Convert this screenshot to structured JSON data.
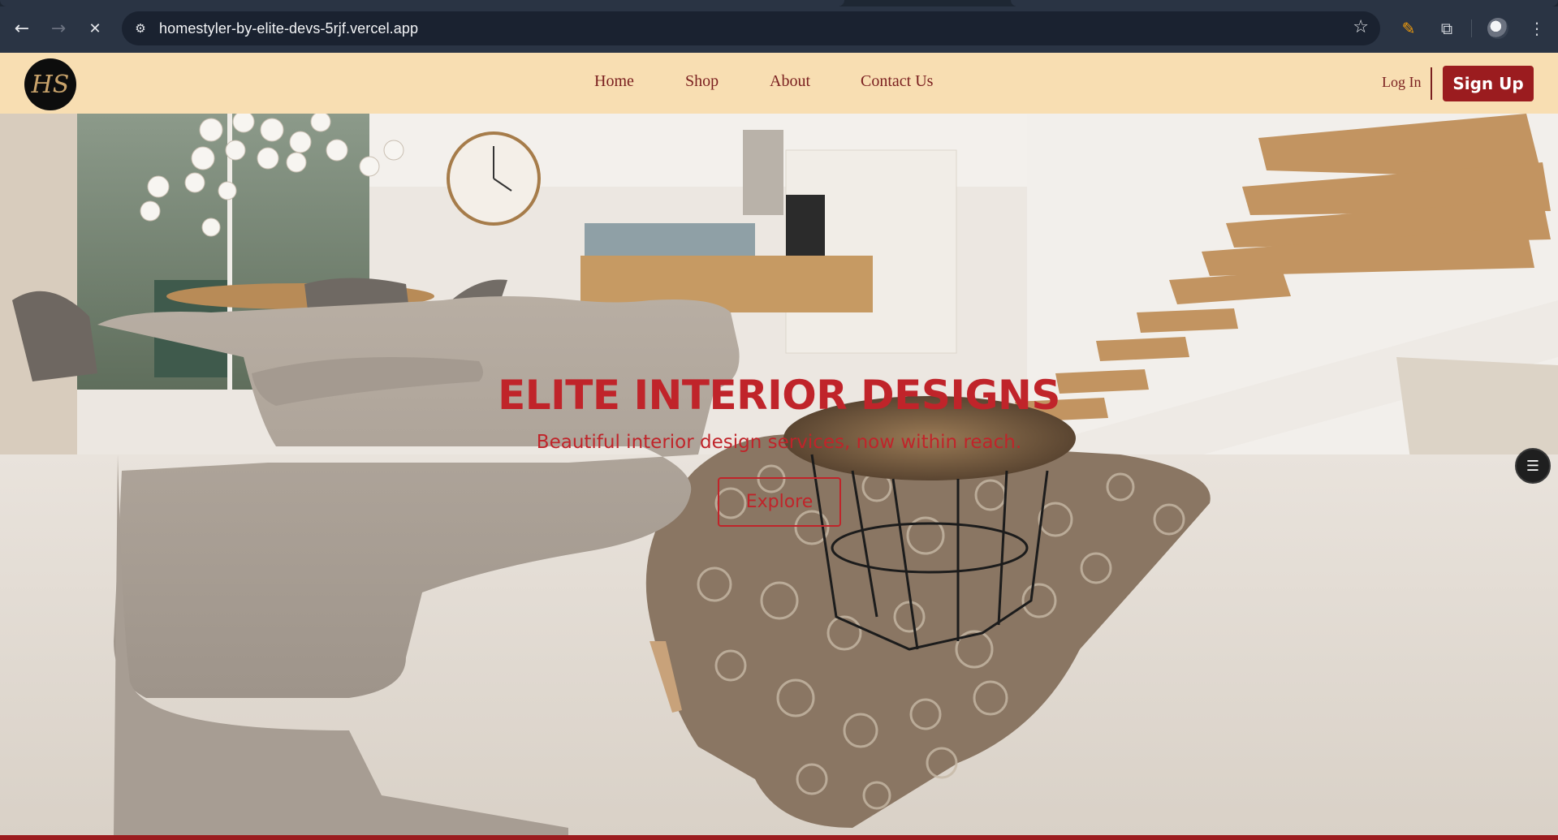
{
  "browser": {
    "url": "homestyler-by-elite-devs-5rjf.vercel.app",
    "back_icon": "←",
    "forward_icon": "→",
    "stop_icon": "✕",
    "site_info_icon": "⚙",
    "star_icon": "☆",
    "pen_icon": "✎",
    "extensions_icon": "⧉",
    "menu_icon": "⋮"
  },
  "nav": {
    "logo_text": "HS",
    "links": [
      "Home",
      "Shop",
      "About",
      "Contact Us"
    ],
    "login_label": "Log In",
    "signup_label": "Sign Up"
  },
  "hero": {
    "title": "ELITE INTERIOR DESIGNS",
    "subtitle": "Beautiful interior design services, now within reach.",
    "cta_label": "Explore"
  },
  "widget": {
    "icon": "☰"
  },
  "colors": {
    "nav_bg": "#f8deb2",
    "brand_red": "#9b1c1f",
    "hero_text": "#c0242a",
    "nav_text": "#7a1f1f"
  }
}
